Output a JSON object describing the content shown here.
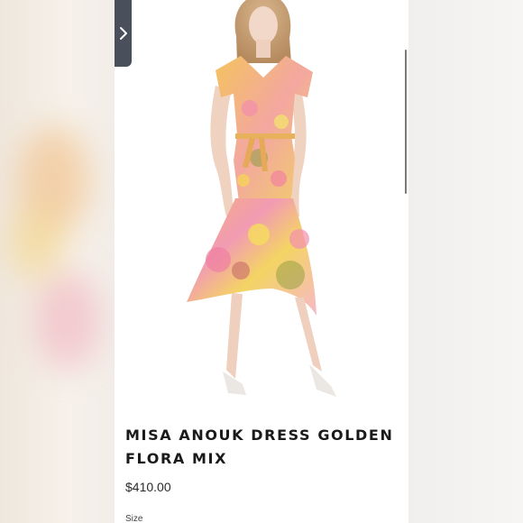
{
  "product": {
    "title_line1": "MISA ANOUK DRESS GOLDEN",
    "title_line2": "FLORA MIX",
    "price": "$410.00",
    "size_label": "Size"
  },
  "image": {
    "alt": "Model wearing floral print midi dress",
    "colors": {
      "dress_base": "#f2c46a",
      "dress_pink": "#f29bb3",
      "dress_yellow": "#f4dc5a",
      "dress_green": "#8a9a3a",
      "skin": "#f1d6c5",
      "hair": "#c9a27a"
    }
  },
  "ui": {
    "nav_icon": "chevron-right-icon",
    "nav_tab_color": "#4a4f5c"
  }
}
